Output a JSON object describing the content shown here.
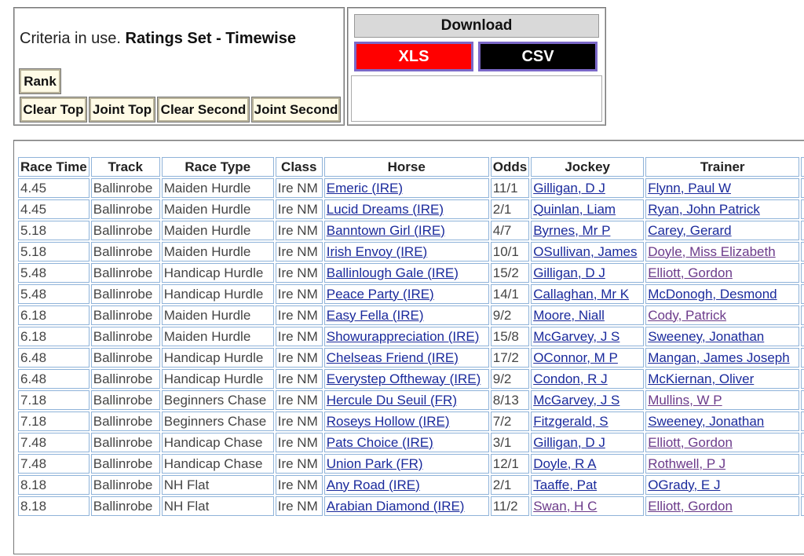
{
  "criteria": {
    "prefix": "Criteria in use. ",
    "ratings_set": "Ratings Set - Timewise",
    "buttons": [
      "Rank",
      "Clear Top",
      "Joint Top",
      "Clear Second",
      "Joint Second"
    ]
  },
  "download": {
    "header": "Download",
    "xls_label": "XLS",
    "csv_label": "CSV",
    "xls_color": "#ff0000",
    "csv_color": "#000000"
  },
  "table": {
    "headers": [
      "Race Time",
      "Track",
      "Race Type",
      "Class",
      "Horse",
      "Odds",
      "Jockey",
      "Trainer"
    ],
    "rows": [
      {
        "time": "4.45",
        "track": "Ballinrobe",
        "type": "Maiden Hurdle",
        "class": "Ire NM",
        "horse": "Emeric (IRE)",
        "odds": "11/1",
        "jockey": "Gilligan, D J",
        "trainer": "Flynn, Paul W",
        "jv": false,
        "tv": false
      },
      {
        "time": "4.45",
        "track": "Ballinrobe",
        "type": "Maiden Hurdle",
        "class": "Ire NM",
        "horse": "Lucid Dreams (IRE)",
        "odds": "2/1",
        "jockey": "Quinlan, Liam",
        "trainer": "Ryan, John Patrick",
        "jv": false,
        "tv": false
      },
      {
        "time": "5.18",
        "track": "Ballinrobe",
        "type": "Maiden Hurdle",
        "class": "Ire NM",
        "horse": "Banntown Girl (IRE)",
        "odds": "4/7",
        "jockey": "Byrnes, Mr P",
        "trainer": "Carey, Gerard",
        "jv": false,
        "tv": false
      },
      {
        "time": "5.18",
        "track": "Ballinrobe",
        "type": "Maiden Hurdle",
        "class": "Ire NM",
        "horse": "Irish Envoy (IRE)",
        "odds": "10/1",
        "jockey": "OSullivan, James",
        "trainer": "Doyle, Miss Elizabeth",
        "jv": false,
        "tv": true
      },
      {
        "time": "5.48",
        "track": "Ballinrobe",
        "type": "Handicap Hurdle",
        "class": "Ire NM",
        "horse": "Ballinlough Gale (IRE)",
        "odds": "15/2",
        "jockey": "Gilligan, D J",
        "trainer": "Elliott, Gordon",
        "jv": false,
        "tv": true
      },
      {
        "time": "5.48",
        "track": "Ballinrobe",
        "type": "Handicap Hurdle",
        "class": "Ire NM",
        "horse": "Peace Party (IRE)",
        "odds": "14/1",
        "jockey": "Callaghan, Mr K",
        "trainer": "McDonogh, Desmond",
        "jv": false,
        "tv": false
      },
      {
        "time": "6.18",
        "track": "Ballinrobe",
        "type": "Maiden Hurdle",
        "class": "Ire NM",
        "horse": "Easy Fella (IRE)",
        "odds": "9/2",
        "jockey": "Moore, Niall",
        "trainer": "Cody, Patrick",
        "jv": false,
        "tv": true
      },
      {
        "time": "6.18",
        "track": "Ballinrobe",
        "type": "Maiden Hurdle",
        "class": "Ire NM",
        "horse": "Showurappreciation (IRE)",
        "odds": "15/8",
        "jockey": "McGarvey, J S",
        "trainer": "Sweeney, Jonathan",
        "jv": false,
        "tv": false
      },
      {
        "time": "6.48",
        "track": "Ballinrobe",
        "type": "Handicap Hurdle",
        "class": "Ire NM",
        "horse": "Chelseas Friend (IRE)",
        "odds": "17/2",
        "jockey": "OConnor, M P",
        "trainer": "Mangan, James Joseph",
        "jv": false,
        "tv": false
      },
      {
        "time": "6.48",
        "track": "Ballinrobe",
        "type": "Handicap Hurdle",
        "class": "Ire NM",
        "horse": "Everystep Oftheway (IRE)",
        "odds": "9/2",
        "jockey": "Condon, R J",
        "trainer": "McKiernan, Oliver",
        "jv": false,
        "tv": false
      },
      {
        "time": "7.18",
        "track": "Ballinrobe",
        "type": "Beginners Chase",
        "class": "Ire NM",
        "horse": "Hercule Du Seuil (FR)",
        "odds": "8/13",
        "jockey": "McGarvey, J S",
        "trainer": "Mullins, W P",
        "jv": false,
        "tv": true
      },
      {
        "time": "7.18",
        "track": "Ballinrobe",
        "type": "Beginners Chase",
        "class": "Ire NM",
        "horse": "Roseys Hollow (IRE)",
        "odds": "7/2",
        "jockey": "Fitzgerald, S",
        "trainer": "Sweeney, Jonathan",
        "jv": false,
        "tv": false
      },
      {
        "time": "7.48",
        "track": "Ballinrobe",
        "type": "Handicap Chase",
        "class": "Ire NM",
        "horse": "Pats Choice (IRE)",
        "odds": "3/1",
        "jockey": "Gilligan, D J",
        "trainer": "Elliott, Gordon",
        "jv": false,
        "tv": true
      },
      {
        "time": "7.48",
        "track": "Ballinrobe",
        "type": "Handicap Chase",
        "class": "Ire NM",
        "horse": "Union Park (FR)",
        "odds": "12/1",
        "jockey": "Doyle, R A",
        "trainer": "Rothwell, P J",
        "jv": false,
        "tv": true
      },
      {
        "time": "8.18",
        "track": "Ballinrobe",
        "type": "NH Flat",
        "class": "Ire NM",
        "horse": "Any Road (IRE)",
        "odds": "2/1",
        "jockey": "Taaffe, Pat",
        "trainer": "OGrady, E J",
        "jv": false,
        "tv": false
      },
      {
        "time": "8.18",
        "track": "Ballinrobe",
        "type": "NH Flat",
        "class": "Ire NM",
        "horse": "Arabian Diamond (IRE)",
        "odds": "11/2",
        "jockey": "Swan, H C",
        "trainer": "Elliott, Gordon",
        "jv": true,
        "tv": true
      }
    ]
  },
  "colors": {
    "link": "#1a2a9c",
    "visited_link": "#6b3a8a",
    "cell_border": "#8fb3d9",
    "button_bg": "#fffbe6"
  }
}
